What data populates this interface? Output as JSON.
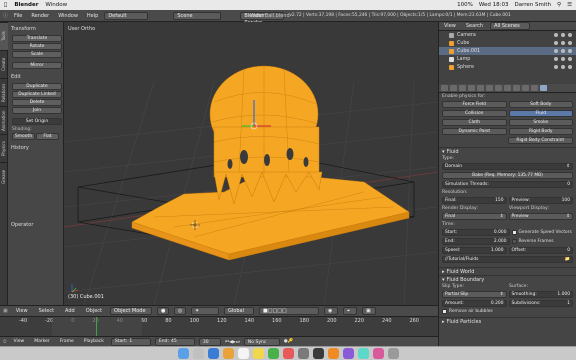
{
  "menubar": {
    "app": "Blender",
    "items": [
      "Window"
    ],
    "right_status": "100%",
    "clock": "Wed 18:03",
    "user": "Darren Smith"
  },
  "header": {
    "window_title": "WaterBall.blend",
    "menus": [
      "File",
      "Render",
      "Window",
      "Help"
    ],
    "layout": "Default",
    "scene": "Scene",
    "engine": "Blender Render",
    "stats": "v2.72 | Verts:37,198 | Faces:55,246 | Tris:97,000 | Objects:1/5 | Lamps:0/1 | Mem:23.63M | Cube.001"
  },
  "left_tabs": [
    "Tools",
    "Create",
    "Relations",
    "Animation",
    "Physics",
    "Grease Pencil"
  ],
  "toolshelf": {
    "transform_header": "Transform",
    "transform": [
      "Translate",
      "Rotate",
      "Scale"
    ],
    "mirror": "Mirror",
    "edit_header": "Edit",
    "edit": [
      "Duplicate",
      "Duplicate Linked",
      "Delete",
      "Join"
    ],
    "set_origin": "Set Origin",
    "shading_label": "Shading:",
    "shading": [
      "Smooth",
      "Flat"
    ],
    "history": "History",
    "operator": "Operator"
  },
  "viewport": {
    "label": "User Ortho",
    "object": "(30) Cube.001"
  },
  "view_header": {
    "menus": [
      "View",
      "Select",
      "Add",
      "Object"
    ],
    "mode": "Object Mode",
    "orientation": "Global"
  },
  "timeline": {
    "ticks": [
      "-40",
      "-20",
      "0",
      "20",
      "40",
      "60",
      "80",
      "100",
      "120",
      "140",
      "160",
      "180",
      "200",
      "220",
      "240",
      "260"
    ],
    "menus": [
      "View",
      "Marker",
      "Frame",
      "Playback"
    ],
    "start": "Start:",
    "start_val": "1",
    "end": "End:",
    "end_val": "45",
    "current": "30",
    "sync": "No Sync"
  },
  "outliner": {
    "view": "View",
    "search": "Search",
    "scenes": "All Scenes",
    "rows": [
      {
        "label": "Camera",
        "selected": false
      },
      {
        "label": "Cube",
        "selected": false
      },
      {
        "label": "Cube.001",
        "selected": true
      },
      {
        "label": "Lamp",
        "selected": false
      },
      {
        "label": "Sphere",
        "selected": false
      }
    ]
  },
  "physics": {
    "enable_label": "Enable physics for:",
    "buttons": [
      [
        "Force Field",
        "Soft Body"
      ],
      [
        "Collision",
        "Fluid"
      ],
      [
        "Cloth",
        "Smoke"
      ],
      [
        "Dynamic Paint",
        "Rigid Body"
      ],
      [
        "",
        "Rigid Body Constraint"
      ]
    ],
    "fluid_header": "Fluid",
    "type_label": "Type:",
    "type_value": "Domain",
    "bake_label": "Bake (Req. Memory: 135.77 MB)",
    "threads_label": "Simulation Threads:",
    "threads_value": "0",
    "resolution_label": "Resolution:",
    "final_label": "Final:",
    "final_value": "150",
    "preview_label": "Preview:",
    "preview_value": "100",
    "render_display": "Render Display:",
    "viewport_display": "Viewport Display:",
    "render_value": "Final",
    "viewport_value": "Preview",
    "time_label": "Time:",
    "start_label": "Start:",
    "start_value": "0.000",
    "end_label": "End:",
    "end_value": "2.000",
    "speed_label": "Speed:",
    "speed_value": "1.000",
    "offset_label": "Offset:",
    "offset_value": "0",
    "gen_speed": "Generate Speed Vectors",
    "reverse": "Reverse Frames",
    "path": "//Tutorial/Fluids",
    "world_header": "Fluid World",
    "boundary_header": "Fluid Boundary",
    "slip_label": "Slip Type:",
    "surface_label": "Surface:",
    "slip_value": "Partial Slip",
    "smoothing_label": "Smoothing:",
    "smoothing_value": "1.000",
    "amount_label": "Amount:",
    "amount_value": "0.200",
    "subdiv_label": "Subdivisions:",
    "subdiv_value": "1",
    "remove_air": "Remove air bubbles",
    "particles_header": "Fluid Particles"
  },
  "colors": {
    "mesh": "#f5a623",
    "grid": "#4a4a4a",
    "selection_blue": "#5a78a8"
  }
}
